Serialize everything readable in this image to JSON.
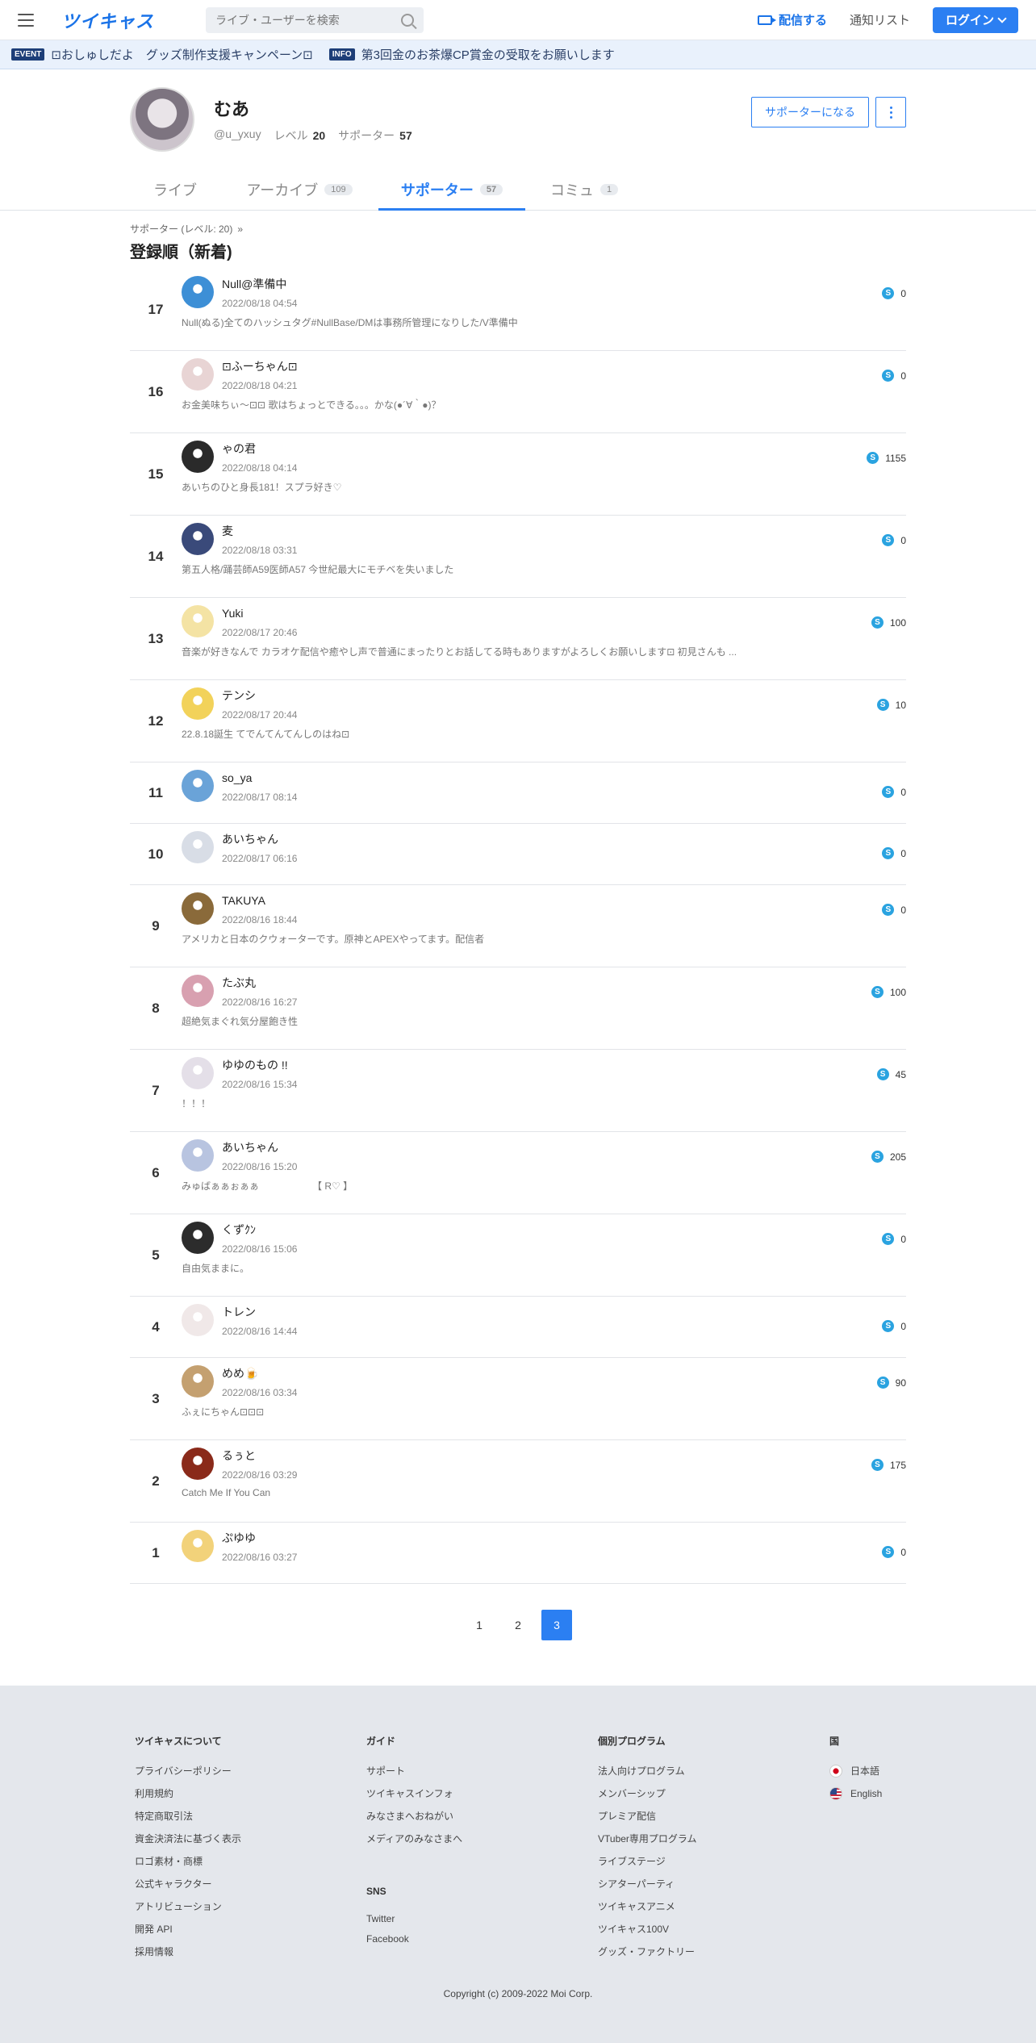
{
  "header": {
    "logo": "ツイキャス",
    "search_placeholder": "ライブ・ユーザーを検索",
    "stream_label": "配信する",
    "notice_label": "通知リスト",
    "login_label": "ログイン"
  },
  "ticker": {
    "event_tag": "EVENT",
    "event_text": "⊡おしゅしだよ　グッズ制作支援キャンペーン⊡",
    "info_tag": "INFO",
    "info_text": "第3回金のお茶爆CP賞金の受取をお願いします"
  },
  "profile": {
    "name": "むあ",
    "handle": "@u_yxuy",
    "level_label": "レベル",
    "level": "20",
    "supporter_label": "サポーター",
    "supporters": "57",
    "become_supporter": "サポーターになる"
  },
  "tabs": [
    {
      "label": "ライブ",
      "count": ""
    },
    {
      "label": "アーカイブ",
      "count": "109"
    },
    {
      "label": "サポーター",
      "count": "57"
    },
    {
      "label": "コミュ",
      "count": "1"
    }
  ],
  "section": {
    "crumb": "サポーター (レベル: 20)",
    "crumb_arrow": "»",
    "title": "登録順（新着)"
  },
  "supporters": [
    {
      "rank": "17",
      "name": "Null@準備中",
      "time": "2022/08/18 04:54",
      "desc": "Null(ぬる)全てのハッシュタグ#NullBase/DMは事務所管理になりした/V準備中",
      "points": "0",
      "avatar": "#3d8fd6"
    },
    {
      "rank": "16",
      "name": "⊡ふーちゃん⊡",
      "time": "2022/08/18 04:21",
      "desc": "お金美味ちぃ～⊡⊡ 歌はちょっとできる。。。かな(●´∀｀●)？",
      "points": "0",
      "avatar": "#e8d4d4"
    },
    {
      "rank": "15",
      "name": "ゃの君",
      "time": "2022/08/18 04:14",
      "desc": "あいちのひと身長181！スプラ好き♡",
      "points": "1155",
      "avatar": "#2a2a2a"
    },
    {
      "rank": "14",
      "name": "麦",
      "time": "2022/08/18 03:31",
      "desc": "第五人格/踊芸師A59医師A57 今世紀最大にモチベを失いました",
      "points": "0",
      "avatar": "#3a4a7a"
    },
    {
      "rank": "13",
      "name": "Yuki",
      "time": "2022/08/17 20:46",
      "desc": "音楽が好きなんで カラオケ配信や癒やし声で普通にまったりとお話してる時もありますがよろしくお願いします⊡ 初見さんも ...",
      "points": "100",
      "avatar": "#f4e3a4"
    },
    {
      "rank": "12",
      "name": "テンシ",
      "time": "2022/08/17 20:44",
      "desc": "22.8.18誕生 てでんてんてんしのはね⊡",
      "points": "10",
      "avatar": "#f2d25a"
    },
    {
      "rank": "11",
      "name": "so_ya",
      "time": "2022/08/17 08:14",
      "desc": "",
      "points": "0",
      "avatar": "#6aa3d8"
    },
    {
      "rank": "10",
      "name": "あいちゃん",
      "time": "2022/08/17 06:16",
      "desc": "",
      "points": "0",
      "avatar": "#d8dde6"
    },
    {
      "rank": "9",
      "name": "TAKUYA",
      "time": "2022/08/16 18:44",
      "desc": "アメリカと日本のクウォーターです。原神とAPEXやってます。配信者",
      "points": "0",
      "avatar": "#8a6a3a"
    },
    {
      "rank": "8",
      "name": "たぶ丸",
      "time": "2022/08/16 16:27",
      "desc": "超絶気まぐれ気分屋飽き性",
      "points": "100",
      "avatar": "#d8a0b0"
    },
    {
      "rank": "7",
      "name": "ゆゆのもの !!",
      "time": "2022/08/16 15:34",
      "desc": "！！！",
      "points": "45",
      "avatar": "#e4dfe8"
    },
    {
      "rank": "6",
      "name": "あいちゃん",
      "time": "2022/08/16 15:20",
      "desc": "みゅばぁぁぉぁぁ　　　　　　【 R♡ 】",
      "points": "205",
      "avatar": "#b8c4e0"
    },
    {
      "rank": "5",
      "name": "くずｸﾝ",
      "time": "2022/08/16 15:06",
      "desc": "自由気ままに。",
      "points": "0",
      "avatar": "#2c2c2c"
    },
    {
      "rank": "4",
      "name": "トレン",
      "time": "2022/08/16 14:44",
      "desc": "",
      "points": "0",
      "avatar": "#f0e8e8"
    },
    {
      "rank": "3",
      "name": "めめ🍺",
      "time": "2022/08/16 03:34",
      "desc": "ふぇにちゃん⊡⊡⊡",
      "points": "90",
      "avatar": "#c4a070"
    },
    {
      "rank": "2",
      "name": "るぅと",
      "time": "2022/08/16 03:29",
      "desc": "Catch Me If You Can",
      "points": "175",
      "avatar": "#8a2a1a"
    },
    {
      "rank": "1",
      "name": "ぷゆゆ",
      "time": "2022/08/16 03:27",
      "desc": "",
      "points": "0",
      "avatar": "#f2d27a"
    }
  ],
  "pager": [
    "1",
    "2",
    "3"
  ],
  "footer": {
    "col1": {
      "title": "ツイキャスについて",
      "links": [
        "プライバシーポリシー",
        "利用規約",
        "特定商取引法",
        "資金決済法に基づく表示",
        "ロゴ素材・商標",
        "公式キャラクター",
        "アトリビューション",
        "開発 API",
        "採用情報"
      ]
    },
    "col2": {
      "title": "ガイド",
      "links": [
        "サポート",
        "ツイキャスインフォ",
        "みなさまへおねがい",
        "メディアのみなさまへ"
      ],
      "sns_title": "SNS",
      "sns": [
        "Twitter",
        "Facebook"
      ]
    },
    "col3": {
      "title": "個別プログラム",
      "links": [
        "法人向けプログラム",
        "メンバーシップ",
        "プレミア配信",
        "VTuber専用プログラム",
        "ライブステージ",
        "シアターパーティ",
        "ツイキャスアニメ",
        "ツイキャス100V",
        "グッズ・ファクトリー"
      ]
    },
    "col4": {
      "title": "国",
      "langs": [
        "日本語",
        "English"
      ]
    },
    "copyright": "Copyright (c) 2009-2022 Moi Corp."
  }
}
